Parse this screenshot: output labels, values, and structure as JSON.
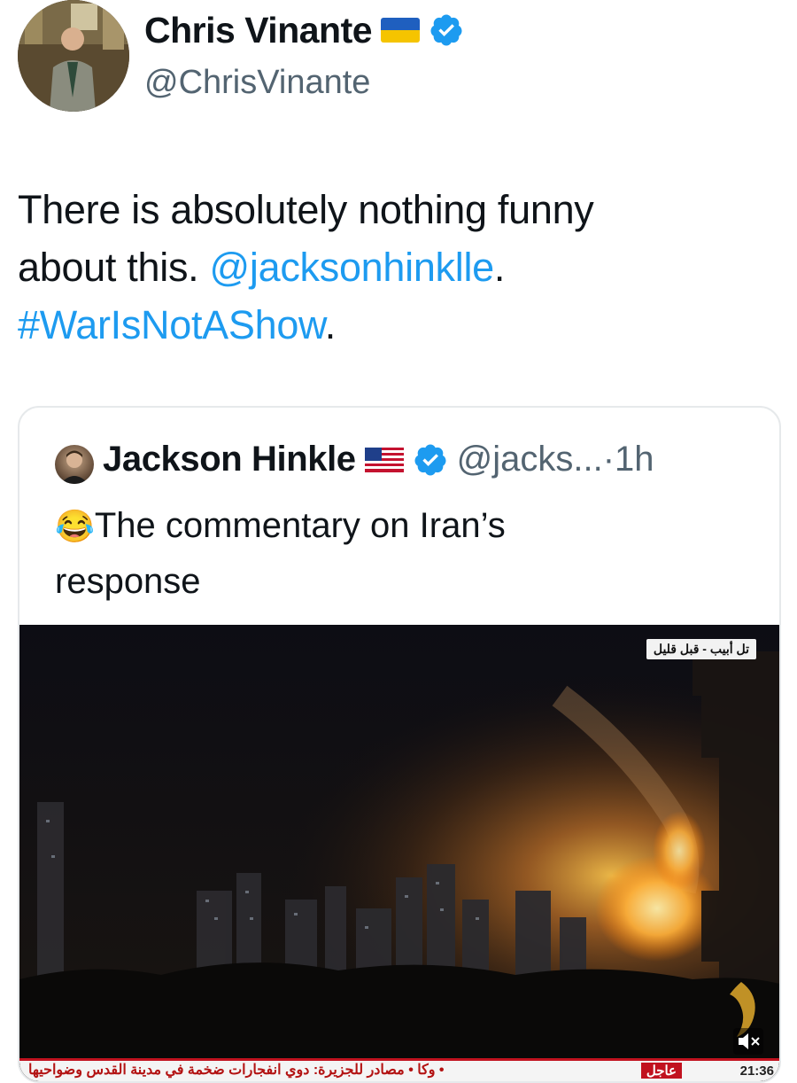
{
  "author": {
    "name": "Chris Vinante",
    "handle": "@ChrisVinante",
    "flag": "ukraine-flag",
    "verified": true
  },
  "tweet": {
    "line1": "There is absolutely nothing funny",
    "line2_prefix": "about this. ",
    "mention": "@jacksonhinklle",
    "line2_suffix": ".",
    "hashtag": "#WarIsNotAShow",
    "line3_suffix": "."
  },
  "quoted": {
    "name": "Jackson Hinkle",
    "flag": "usa-flag",
    "handle_time": "@jacks...·1h",
    "emoji": "😂",
    "text_line1": "The commentary on Iran’s",
    "text_line2": "response"
  },
  "video": {
    "top_tag": "تل أبيب - قبل قليل",
    "ticker_text": "وكا   •   مصادر للجزيرة: دوي انفجارات ضخمة في مدينة القدس وضواحيها   •",
    "urgent_label": "عاجل",
    "time": "21:36"
  },
  "colors": {
    "link": "#1d9bf0",
    "text": "#0f1419",
    "muted": "#536471"
  }
}
